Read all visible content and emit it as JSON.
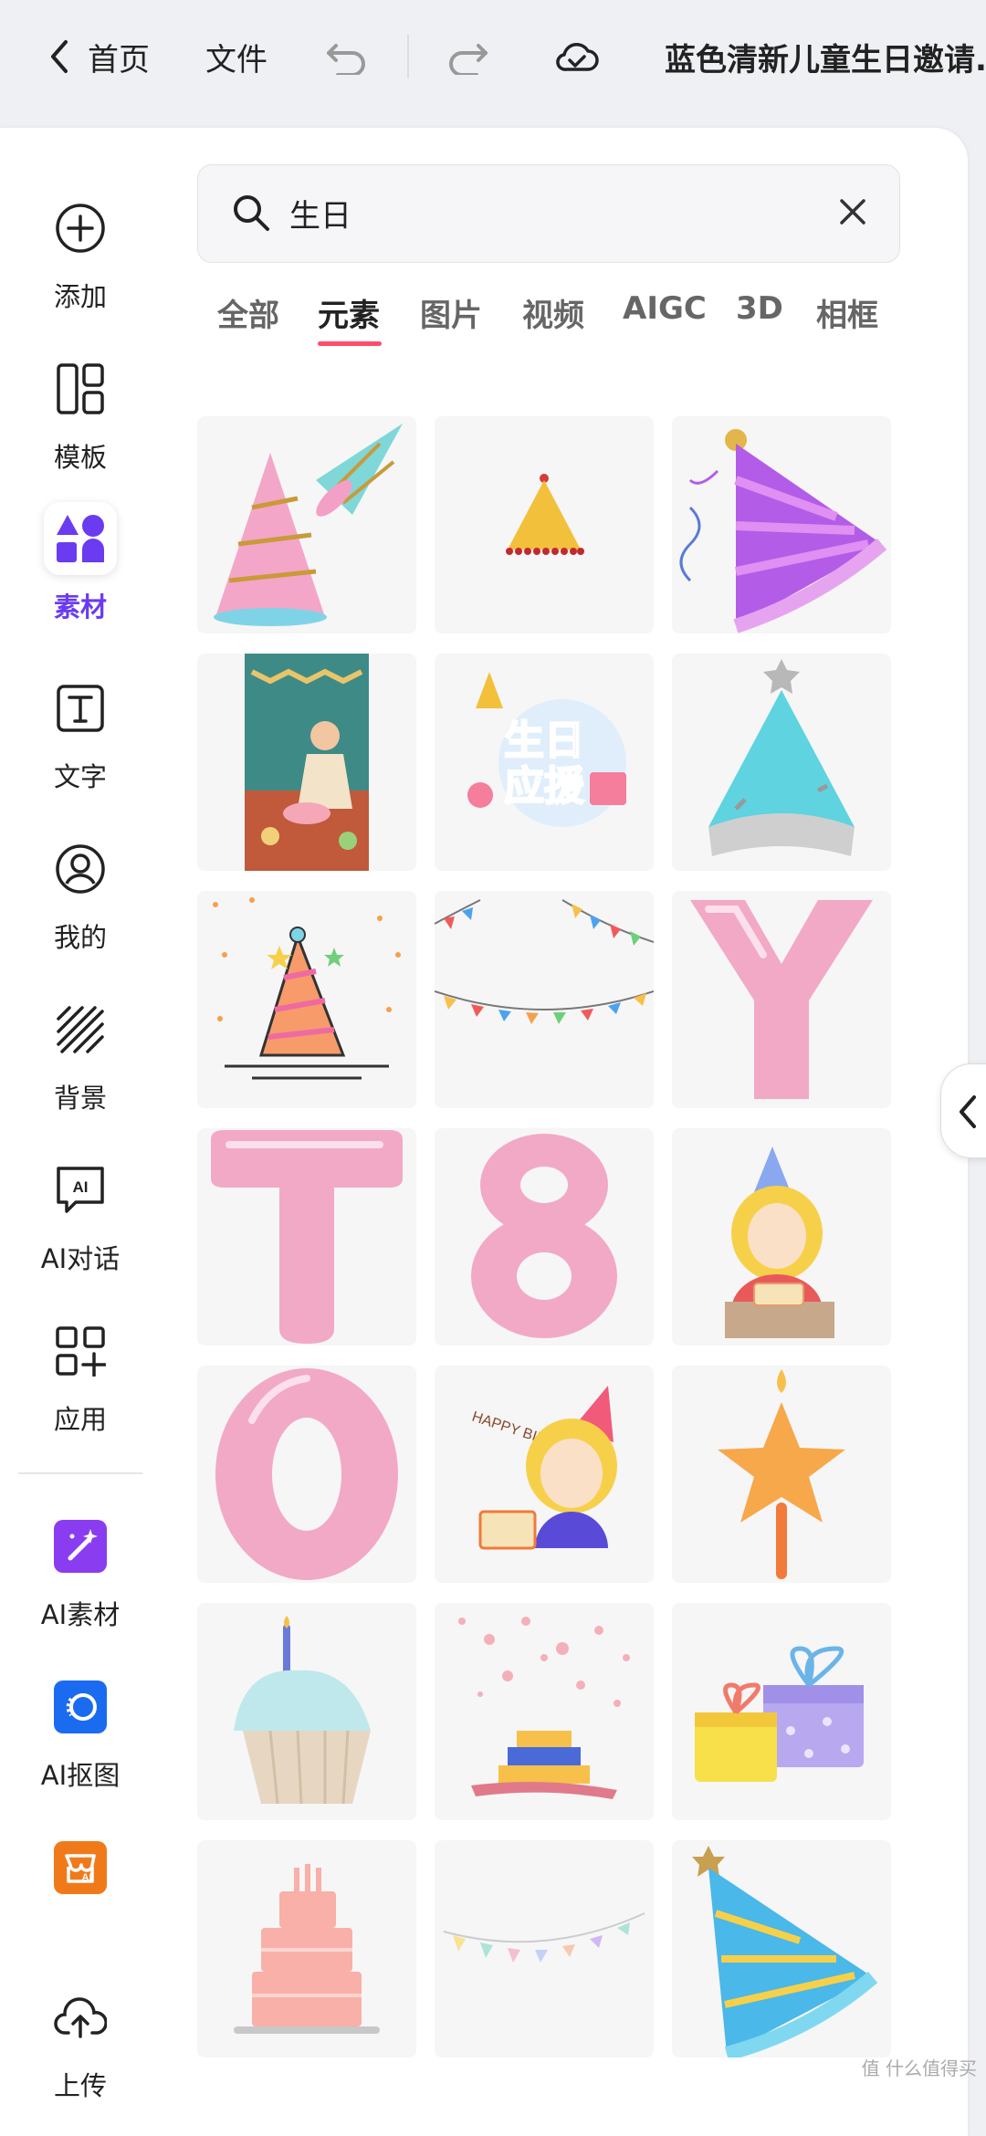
{
  "topbar": {
    "back_label": "首页",
    "file_label": "文件",
    "doc_title": "蓝色清新儿童生日邀请..."
  },
  "sidebar": {
    "items": [
      {
        "label": "添加",
        "icon": "plus-circle-icon"
      },
      {
        "label": "模板",
        "icon": "template-icon"
      },
      {
        "label": "素材",
        "icon": "elements-icon",
        "active": true
      },
      {
        "label": "文字",
        "icon": "text-icon"
      },
      {
        "label": "我的",
        "icon": "user-icon"
      },
      {
        "label": "背景",
        "icon": "background-icon"
      },
      {
        "label": "AI对话",
        "icon": "ai-chat-icon"
      },
      {
        "label": "应用",
        "icon": "apps-icon"
      },
      {
        "label": "AI素材",
        "icon": "ai-material-icon"
      },
      {
        "label": "AI抠图",
        "icon": "ai-cutout-icon"
      },
      {
        "label": "",
        "icon": "ai-store-icon"
      },
      {
        "label": "上传",
        "icon": "upload-icon"
      }
    ]
  },
  "search": {
    "value": "生日"
  },
  "tabs": [
    {
      "label": "全部"
    },
    {
      "label": "元素",
      "active": true
    },
    {
      "label": "图片"
    },
    {
      "label": "视频"
    },
    {
      "label": "AIGC"
    },
    {
      "label": "3D"
    },
    {
      "label": "相框"
    }
  ],
  "grid_items": [
    "pink-blue-party-hats",
    "small-yellow-party-hat",
    "purple-party-hat",
    "birthday-illustration-girl-cake",
    "birthday-cheer-sticker",
    "teal-silver-party-hat",
    "party-hat-confetti-line",
    "colorful-bunting",
    "pink-balloon-letter-y",
    "pink-balloon-letter-t",
    "pink-balloon-number-8",
    "girl-birthday-cake",
    "pink-balloon-number-0",
    "happy-birthday-girl",
    "star-candle",
    "cupcake-candle",
    "confetti-cake",
    "gift-boxes",
    "pink-cake",
    "pastel-bunting",
    "blue-party-hat"
  ],
  "sticker_text": {
    "shengri": "生日",
    "yingyuan": "应援",
    "happy_birthday": "HAPPY BIRTHDAY"
  },
  "watermark": "值 什么值得买",
  "colors": {
    "accent_purple": "#6a3bf0",
    "tab_underline": "#ff4d6d",
    "balloon_pink": "#f2a9c6"
  }
}
